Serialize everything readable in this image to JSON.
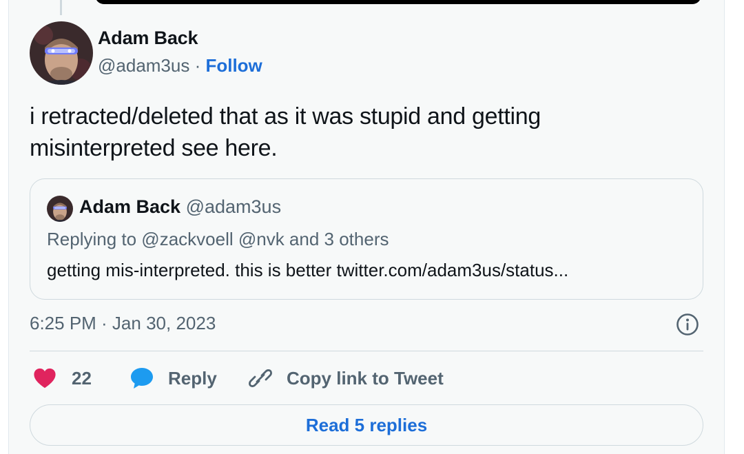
{
  "tweet": {
    "author_name": "Adam Back",
    "author_handle": "@adam3us",
    "separator": " · ",
    "follow_label": "Follow",
    "text_line1": "i retracted/deleted that as it was stupid and getting",
    "text_line2": "misinterpreted see here.",
    "timestamp": "6:25 PM · Jan 30, 2023"
  },
  "quoted_tweet": {
    "author_name": "Adam Back",
    "author_handle": "@adam3us",
    "replying_to": "Replying to @zackvoell @nvk and 3 others",
    "text": "getting mis-interpreted. this is better twitter.com/adam3us/status..."
  },
  "actions": {
    "like_count": "22",
    "reply_label": "Reply",
    "copy_link_label": "Copy link to Tweet",
    "read_replies_label": "Read 5 replies"
  },
  "icons": {
    "like": "heart-icon",
    "reply": "speech-bubble-icon",
    "copy_link": "link-icon",
    "info": "info-icon"
  },
  "colors": {
    "link_blue": "#1d6ed8",
    "like_pink": "#f91880",
    "reply_blue": "#1d9bf0",
    "muted_text": "#536471",
    "card_bg": "#f7f9f9"
  }
}
